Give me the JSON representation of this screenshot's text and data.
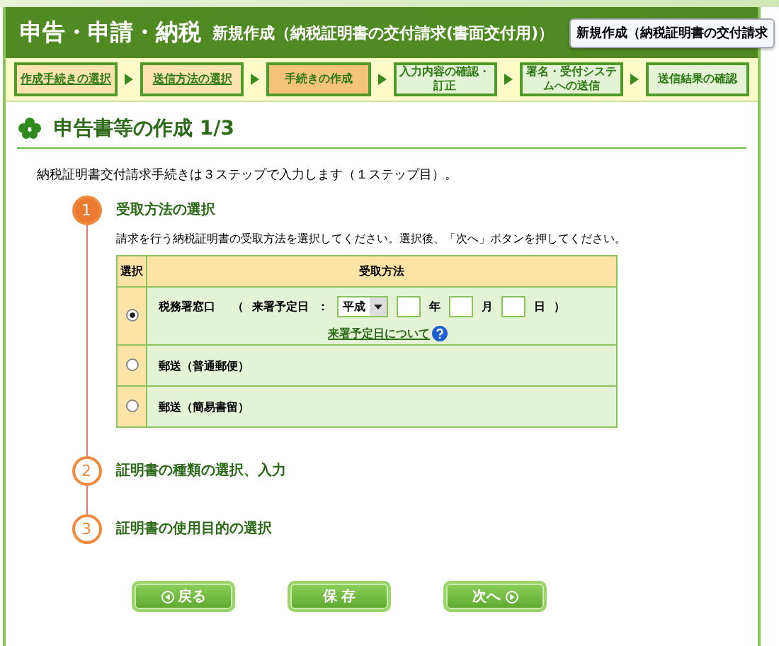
{
  "header": {
    "title": "申告・申請・納税",
    "subtitle": "新規作成（納税証明書の交付請求(書面交付用)）",
    "tooltip": "新規作成（納税証明書の交付請求"
  },
  "progress_steps": [
    {
      "label": "作成手続きの選択",
      "completed": true,
      "selected": false
    },
    {
      "label": "送信方法の選択",
      "completed": true,
      "selected": false
    },
    {
      "label": "手続きの作成",
      "completed": false,
      "selected": true
    },
    {
      "label": "入力内容の確認・訂正",
      "completed": false,
      "selected": false
    },
    {
      "label": "署名・受付システムへの送信",
      "completed": false,
      "selected": false
    },
    {
      "label": "送信結果の確認",
      "completed": false,
      "selected": false
    }
  ],
  "page_heading": "申告書等の作成 1/3",
  "intro": "納税証明書交付請求手続きは３ステップで入力します（１ステップ目）。",
  "sections": [
    {
      "number": "1",
      "title": "受取方法の選択",
      "active": true,
      "instruction": "請求を行う納税証明書の受取方法を選択してください。選択後、「次へ」ボタンを押してください。",
      "table": {
        "columns": [
          "選択",
          "受取方法"
        ],
        "rows": [
          {
            "kind": "date",
            "label": "税務署窓口",
            "selected": true,
            "open_paren": "（",
            "date_label": "来署予定日",
            "colon": "：",
            "era": "平成",
            "year_unit": "年",
            "month_unit": "月",
            "day_unit": "日",
            "close_paren": "）",
            "help_link": "来署予定日について"
          },
          {
            "kind": "plain",
            "label": "郵送（普通郵便）",
            "selected": false
          },
          {
            "kind": "plain",
            "label": "郵送（簡易書留）",
            "selected": false
          }
        ]
      }
    },
    {
      "number": "2",
      "title": "証明書の種類の選択、入力",
      "active": false
    },
    {
      "number": "3",
      "title": "証明書の使用目的の選択",
      "active": false
    }
  ],
  "buttons": [
    {
      "kind": "back",
      "label": "戻る"
    },
    {
      "kind": "save",
      "label": "保 存"
    },
    {
      "kind": "next",
      "label": "次へ"
    }
  ]
}
